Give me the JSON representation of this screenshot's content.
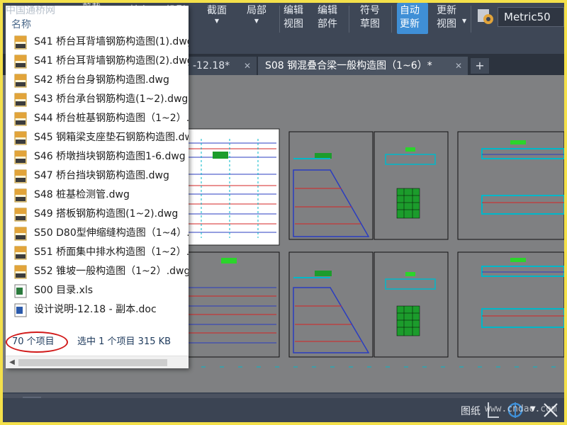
{
  "ribbon": {
    "buttons": [
      {
        "id": "base",
        "label": "基点"
      },
      {
        "id": "project",
        "label": "投影"
      },
      {
        "id": "section",
        "label": "截面"
      },
      {
        "id": "detail",
        "label": "局部"
      },
      {
        "id": "edit-view",
        "line1": "编辑",
        "line2": "视图"
      },
      {
        "id": "edit-part",
        "line1": "编辑",
        "line2": "部件"
      },
      {
        "id": "symbol-sketch",
        "line1": "符号",
        "line2": "草图"
      },
      {
        "id": "auto-update",
        "line1": "自动",
        "line2": "更新"
      },
      {
        "id": "update-view",
        "line1": "更新",
        "line2": "视图"
      }
    ],
    "clip_label": "剪裁",
    "style_combo": "Metric50",
    "accent_color": "#3f8fd6"
  },
  "tabs": [
    {
      "label": "-12.18*"
    },
    {
      "label": "S08 钢混叠合梁一般构造图（1~6）*"
    }
  ],
  "explorer": {
    "watermark": "中国通桥网",
    "header": "名称",
    "files": [
      {
        "name": "S41  桥台耳背墙钢筋构造图(1).dwg",
        "type": "dwg"
      },
      {
        "name": "S41  桥台耳背墙钢筋构造图(2).dwg",
        "type": "dwg"
      },
      {
        "name": "S42 桥台台身钢筋构造图.dwg",
        "type": "dwg"
      },
      {
        "name": "S43 桥台承台钢筋构造(1~2).dwg",
        "type": "dwg"
      },
      {
        "name": "S44 桥台桩基钢筋构造图（1~2）.dwg",
        "type": "dwg"
      },
      {
        "name": "S45 钢箱梁支座垫石钢筋构造图.dwg",
        "type": "dwg"
      },
      {
        "name": "S46  桥墩挡块钢筋构造图1-6.dwg",
        "type": "dwg"
      },
      {
        "name": "S47  桥台挡块钢筋构造图.dwg",
        "type": "dwg"
      },
      {
        "name": "S48 桩基检测管.dwg",
        "type": "dwg"
      },
      {
        "name": "S49 搭板钢筋构造图(1~2).dwg",
        "type": "dwg"
      },
      {
        "name": "S50 D80型伸缩缝构造图（1~4）.dwg",
        "type": "dwg"
      },
      {
        "name": "S51 桥面集中排水构造图（1~2）.dwg",
        "type": "dwg"
      },
      {
        "name": "S52 锥坡一般构造图（1~2）.dwg",
        "type": "dwg"
      },
      {
        "name": "S00 目录.xls",
        "type": "xls"
      },
      {
        "name": "设计说明-12.18 - 副本.doc",
        "type": "doc"
      }
    ],
    "item_count": "70 个项目",
    "selected_info": "选中 1 个项目  315 KB",
    "highlight_color": "#d11a1a"
  },
  "status": {
    "paper_label": "图纸",
    "watermark": "www.cndao.com"
  }
}
